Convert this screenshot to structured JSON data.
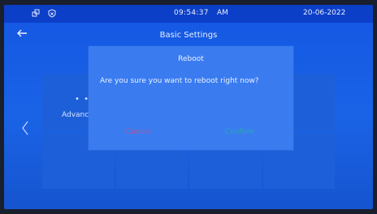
{
  "status": {
    "time": "09:54:37",
    "ampm": "AM",
    "date": "20-06-2022"
  },
  "header": {
    "title": "Basic Settings"
  },
  "grid": {
    "visible_tile_label": "Advanc",
    "visible_tile_dots": "• • •"
  },
  "dialog": {
    "title": "Reboot",
    "message": "Are you sure you want to reboot right now?",
    "cancel": "Cancel",
    "confirm": "Confirm"
  },
  "colors": {
    "statusbar": "#0c3fc7",
    "background": "#1a63e6",
    "dialog": "#3a7cf0",
    "cancel": "#b0579a",
    "confirm": "#2aa7b2"
  }
}
